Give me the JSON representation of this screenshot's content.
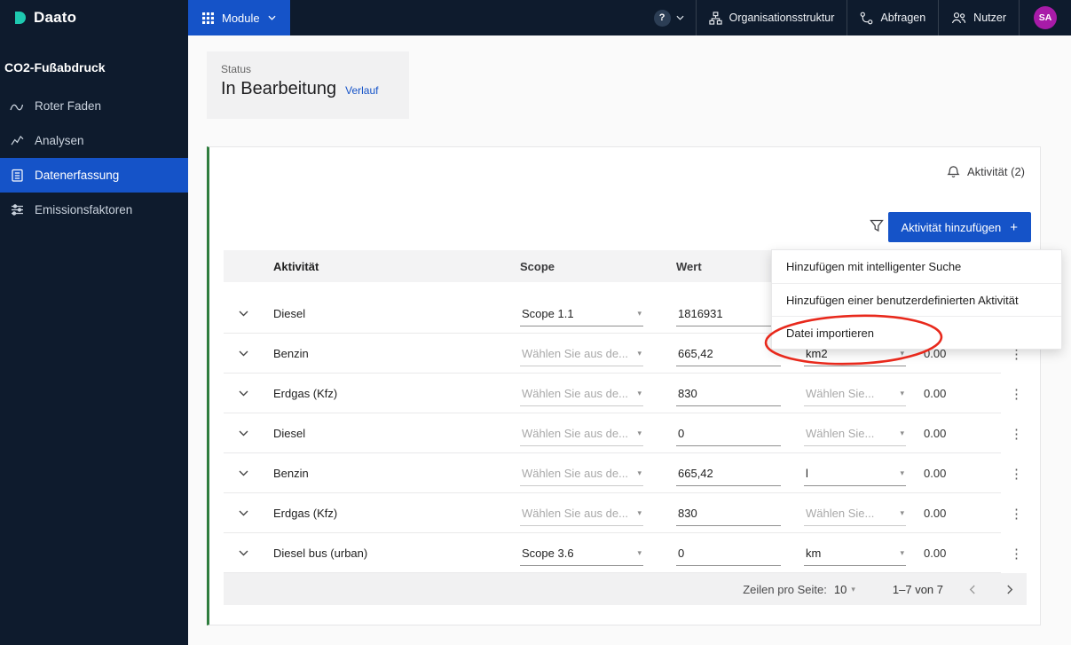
{
  "topbar": {
    "logo_text": "Daato",
    "module_label": "Module",
    "help_glyph": "?",
    "nav_items": [
      {
        "label": "Organisationsstruktur"
      },
      {
        "label": "Abfragen"
      },
      {
        "label": "Nutzer"
      }
    ],
    "avatar_initials": "SA"
  },
  "sidebar": {
    "title": "CO2-Fußabdruck",
    "items": [
      {
        "label": "Roter Faden"
      },
      {
        "label": "Analysen"
      },
      {
        "label": "Datenerfassung"
      },
      {
        "label": "Emissionsfaktoren"
      }
    ]
  },
  "status": {
    "label": "Status",
    "value": "In Bearbeitung",
    "link": "Verlauf"
  },
  "panel": {
    "activity_label": "Aktivität (2)",
    "add_button_label": "Aktivität hinzufügen",
    "add_button_plus": "+",
    "menu_items": [
      {
        "label": "Hinzufügen mit intelligenter Suche"
      },
      {
        "label": "Hinzufügen einer benutzerdefinierten Aktivität"
      },
      {
        "label": "Datei importieren"
      }
    ],
    "table": {
      "headers": {
        "aktivitaet": "Aktivität",
        "scope": "Scope",
        "wert": "Wert"
      },
      "rows": [
        {
          "aktivitaet": "Diesel",
          "scope": "Scope 1.1",
          "wert": "1816931",
          "einheit": "",
          "value": ""
        },
        {
          "aktivitaet": "Benzin",
          "scope": "Wählen Sie aus de...",
          "wert": "665,42",
          "einheit": "km2",
          "value": "0.00"
        },
        {
          "aktivitaet": "Erdgas (Kfz)",
          "scope": "Wählen Sie aus de...",
          "wert": "830",
          "einheit": "Wählen Sie...",
          "value": "0.00"
        },
        {
          "aktivitaet": "Diesel",
          "scope": "Wählen Sie aus de...",
          "wert": "0",
          "einheit": "Wählen Sie...",
          "value": "0.00"
        },
        {
          "aktivitaet": "Benzin",
          "scope": "Wählen Sie aus de...",
          "wert": "665,42",
          "einheit": "l",
          "value": "0.00"
        },
        {
          "aktivitaet": "Erdgas (Kfz)",
          "scope": "Wählen Sie aus de...",
          "wert": "830",
          "einheit": "Wählen Sie...",
          "value": "0.00"
        },
        {
          "aktivitaet": "Diesel bus (urban)",
          "scope": "Scope 3.6",
          "wert": "0",
          "einheit": "km",
          "value": "0.00"
        }
      ],
      "footer": {
        "rows_per_page_label": "Zeilen pro Seite:",
        "rows_per_page_value": "10",
        "range": "1–7 von 7"
      }
    }
  },
  "icons": {
    "caret_down": "▾",
    "kebab": "⋮"
  },
  "colors": {
    "accent": "#1553c8",
    "navy": "#0e1b2d",
    "green_border": "#2f7d3e",
    "avatar": "#a81ba8",
    "logo_teal": "#1ec9b0",
    "annotation_red": "#e8291c"
  }
}
